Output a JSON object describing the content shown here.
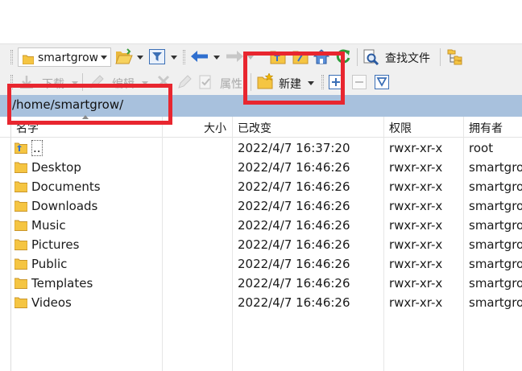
{
  "toolbar1": {
    "path_combo_value": "smartgrow",
    "find_files_label": "查找文件"
  },
  "toolbar2": {
    "download_label": "下载",
    "edit_label": "编辑",
    "properties_label": "属性",
    "new_label": "新建"
  },
  "address": {
    "path": "/home/smartgrow/"
  },
  "columns": {
    "name": "名字",
    "size": "大小",
    "modified": "已改变",
    "permissions": "权限",
    "owner": "拥有者"
  },
  "files": [
    {
      "name": "..",
      "icon": "parent-folder-icon",
      "modified": "2022/4/7 16:37:20",
      "permissions": "rwxr-xr-x",
      "owner": "root"
    },
    {
      "name": "Desktop",
      "icon": "folder-icon",
      "modified": "2022/4/7 16:46:26",
      "permissions": "rwxr-xr-x",
      "owner": "smartgrow"
    },
    {
      "name": "Documents",
      "icon": "folder-icon",
      "modified": "2022/4/7 16:46:26",
      "permissions": "rwxr-xr-x",
      "owner": "smartgrow"
    },
    {
      "name": "Downloads",
      "icon": "folder-icon",
      "modified": "2022/4/7 16:46:26",
      "permissions": "rwxr-xr-x",
      "owner": "smartgrow"
    },
    {
      "name": "Music",
      "icon": "folder-icon",
      "modified": "2022/4/7 16:46:26",
      "permissions": "rwxr-xr-x",
      "owner": "smartgrow"
    },
    {
      "name": "Pictures",
      "icon": "folder-icon",
      "modified": "2022/4/7 16:46:26",
      "permissions": "rwxr-xr-x",
      "owner": "smartgrow"
    },
    {
      "name": "Public",
      "icon": "folder-icon",
      "modified": "2022/4/7 16:46:26",
      "permissions": "rwxr-xr-x",
      "owner": "smartgrow"
    },
    {
      "name": "Templates",
      "icon": "folder-icon",
      "modified": "2022/4/7 16:46:26",
      "permissions": "rwxr-xr-x",
      "owner": "smartgrow"
    },
    {
      "name": "Videos",
      "icon": "folder-icon",
      "modified": "2022/4/7 16:46:26",
      "permissions": "rwxr-xr-x",
      "owner": "smartgrow"
    }
  ],
  "colors": {
    "address_bar": "#a8c1dd",
    "highlight": "#e8262f",
    "folder": "#f5c542"
  }
}
